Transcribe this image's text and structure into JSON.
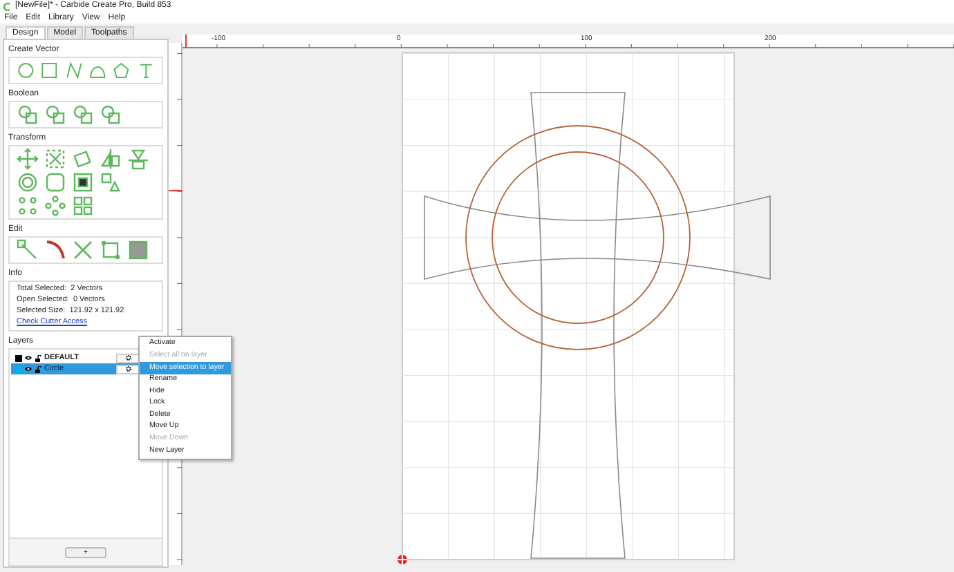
{
  "window": {
    "title": "[NewFile]* - Carbide Create Pro, Build 853"
  },
  "menu": [
    "File",
    "Edit",
    "Library",
    "View",
    "Help"
  ],
  "tabs": [
    {
      "label": "Design",
      "selected": true
    },
    {
      "label": "Model",
      "selected": false
    },
    {
      "label": "Toolpaths",
      "selected": false
    }
  ],
  "sections": {
    "create_vector": "Create Vector",
    "boolean": "Boolean",
    "transform": "Transform",
    "edit": "Edit",
    "info": "Info",
    "layers": "Layers"
  },
  "info": {
    "lines": [
      "Total Selected:  2 Vectors",
      "Open Selected:  0 Vectors",
      "Selected Size:  121.92 x 121.92"
    ],
    "link": "Check Cutter Access"
  },
  "layers": [
    {
      "name": "DEFAULT",
      "color": "#000000",
      "selected": false
    },
    {
      "name": "Circle",
      "color": "#00b4f0",
      "selected": true
    }
  ],
  "add_layer_button": "+",
  "context_menu": [
    {
      "label": "Activate",
      "disabled": false,
      "selected": false
    },
    {
      "label": "Select all on layer",
      "disabled": true,
      "selected": false
    },
    {
      "label": "Move selection to layer",
      "disabled": false,
      "selected": true
    },
    {
      "label": "Rename",
      "disabled": false,
      "selected": false
    },
    {
      "label": "Hide",
      "disabled": false,
      "selected": false
    },
    {
      "label": "Lock",
      "disabled": false,
      "selected": false
    },
    {
      "label": "Delete",
      "disabled": false,
      "selected": false
    },
    {
      "label": "Move Up",
      "disabled": false,
      "selected": false
    },
    {
      "label": "Move Down",
      "disabled": true,
      "selected": false
    },
    {
      "label": "New Layer",
      "disabled": false,
      "selected": false
    }
  ],
  "ruler": {
    "labels": [
      "-100",
      "0",
      "100",
      "200"
    ]
  }
}
